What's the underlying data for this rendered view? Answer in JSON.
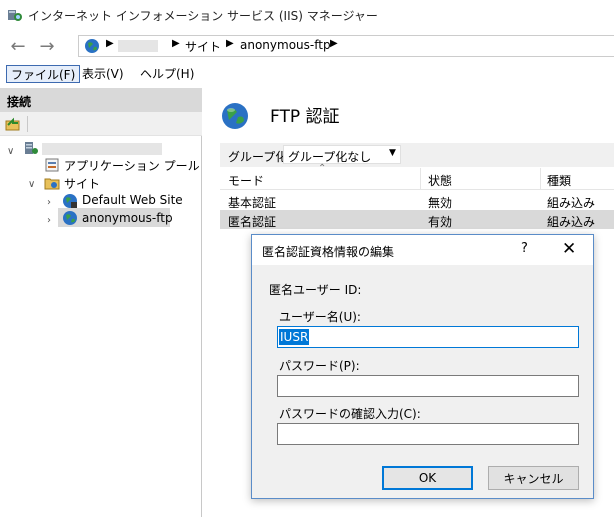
{
  "window": {
    "title": "インターネット インフォメーション サービス (IIS) マネージャー"
  },
  "address": {
    "segments": [
      "サイト",
      "anonymous-ftp"
    ]
  },
  "menu": {
    "items": [
      "ファイル(F)",
      "表示(V)",
      "ヘルプ(H)"
    ]
  },
  "connections": {
    "title": "接続",
    "tree": {
      "app_pools": "アプリケーション プール",
      "sites": "サイト",
      "default_site": "Default Web Site",
      "anon_site": "anonymous-ftp"
    }
  },
  "feature": {
    "title": "FTP 認証",
    "group_label": "グループ化:",
    "group_value": "グループ化なし",
    "columns": [
      "モード",
      "状態",
      "種類"
    ],
    "rows": [
      {
        "mode": "基本認証",
        "status": "無効",
        "type": "組み込み"
      },
      {
        "mode": "匿名認証",
        "status": "有効",
        "type": "組み込み"
      }
    ]
  },
  "dialog": {
    "title": "匿名認証資格情報の編集",
    "help": "?",
    "heading": "匿名ユーザー ID:",
    "username_label": "ユーザー名(U):",
    "username_value": "IUSR",
    "password_label": "パスワード(P):",
    "confirm_label": "パスワードの確認入力(C):",
    "ok": "OK",
    "cancel": "キャンセル"
  },
  "colors": {
    "accent": "#0078d7",
    "selection": "#d9d9d9"
  },
  "icons": [
    "iis-manager-icon",
    "back-arrow-icon",
    "forward-arrow-icon",
    "globe-icon",
    "server-icon",
    "app-pool-icon",
    "sites-folder-icon",
    "website-globe-icon",
    "close-icon"
  ]
}
